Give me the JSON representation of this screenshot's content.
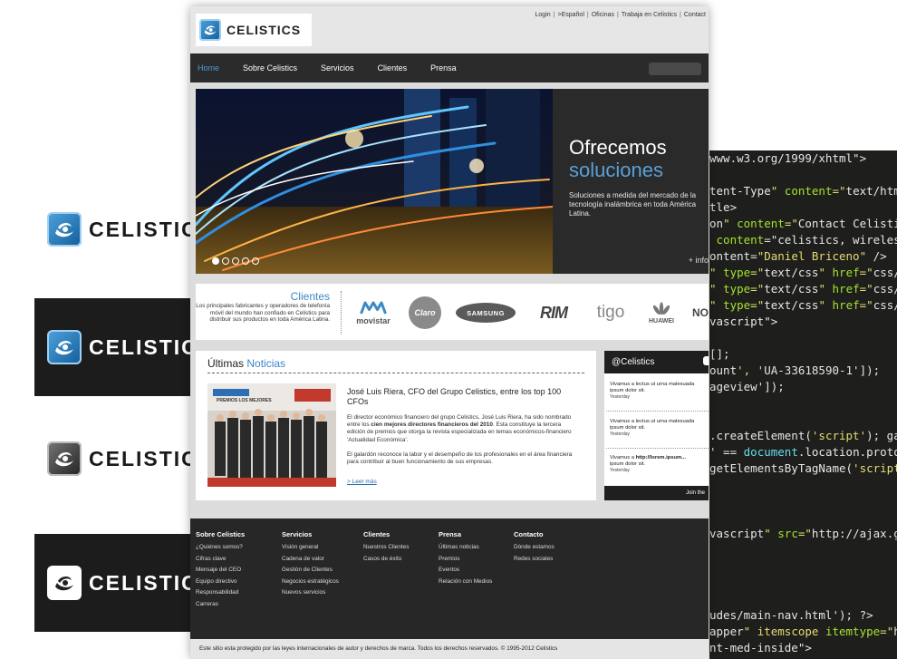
{
  "collage": {
    "brand": "CELISTICS",
    "code_lines": [
      "www.w3.org/1999/xhtml\">",
      "",
      "tent-Type\" content=\"text/html",
      "tle>",
      "on\" content=\"Contact Celistic",
      " content=\"celistics, wireless",
      "ontent=\"Daniel Briceno\" />",
      "\" type=\"text/css\" href=\"css/s",
      "\" type=\"text/css\" href=\"css/r",
      "\" type=\"text/css\" href=\"css/t",
      "vascript\">",
      "",
      "[];",
      "ount', 'UA-33618590-1']);",
      "ageview']);",
      "",
      "",
      ".createElement('script'); ga.",
      "' == document.location.protoc",
      "getElementsByTagName('script'",
      "",
      "",
      "",
      "vascript\" src=\"http://ajax.go",
      "",
      "",
      "",
      "",
      "udes/main-nav.html'); ?>",
      "apper\" itemscope itemtype=\"ht",
      "nt-med-inside\">"
    ]
  },
  "site": {
    "logo_text": "CELISTICS",
    "utility_links": [
      "Login",
      ">Español",
      "Oficinas",
      "Trabaja en Celistics",
      "Contact"
    ],
    "nav": [
      {
        "label": "Home",
        "active": true
      },
      {
        "label": "Sobre Celistics"
      },
      {
        "label": "Servicios"
      },
      {
        "label": "Clientes"
      },
      {
        "label": "Prensa"
      }
    ],
    "hero": {
      "title_line1": "Ofrecemos",
      "title_line2": "soluciones",
      "description": "Soluciones a medida del mercado de la tecnología inalámbrica en toda América Latina.",
      "more_link": "+ info",
      "slides": 5,
      "active_slide": 1
    },
    "clients": {
      "title": "Clientes",
      "description": "Los principales fabricantes y operadores de telefonía móvil del mundo han confiado en Celistics para distribuir sus productos en toda América Latina.",
      "brands": [
        "movistar",
        "Claro",
        "SAMSUNG",
        "RIM",
        "tigo",
        "HUAWEI",
        "NO"
      ]
    },
    "news": {
      "title_plain": "Últimas",
      "title_accent": "Noticias",
      "headline": "José Luis Riera, CFO del Grupo Celistics, entre los top 100 CFOs",
      "para1_a": "El director económico financiero del grupo Celistics, José Luis Riera, ha sido nombrado entre los ",
      "para1_b": "cien mejores directores financieros del 2010",
      "para1_c": ". Esta constituye la tercera edición de premios que otorga la revista especializada en temas económicos-financiero 'Actualidad Económica'.",
      "para2": "El galardón reconoce la labor y el desempeño de los profesionales en el área financiera para contribuir al buen funcionamiento de sus empresas.",
      "more_link": "> Leer más",
      "image_caption": "PREMIOS LOS MEJORES"
    },
    "twitter": {
      "handle": "@Celistics",
      "tweets": [
        {
          "text": "Vivamus a lectus ut urna malesuada",
          "text2": "ipsum dolor sit.",
          "when": "Yesterday"
        },
        {
          "text": "Vivamus a lectus ut urna malesuada",
          "text2": "ipsum dolor sit.",
          "when": "Yesterday"
        },
        {
          "text_a": "Vivamus a ",
          "link": "http://lorem.ipsum...",
          "text2": "ipsum dolor sit.",
          "when": "Yesterday"
        }
      ],
      "footer": "Join the"
    },
    "footer": {
      "columns": [
        {
          "heading": "Sobre Celistics",
          "links": [
            "¿Quiénes somos?",
            "Cifras clave",
            "Mensaje del CEO",
            "Equipo directivo",
            "Responsabilidad",
            "Carreras"
          ]
        },
        {
          "heading": "Servicios",
          "links": [
            "Visión general",
            "Cadena de valor",
            "Gestión de Clientes",
            "Negocios estratégicos",
            "Nuevos servicios"
          ]
        },
        {
          "heading": "Clientes",
          "links": [
            "Nuestros Clientes",
            "Casos de éxito"
          ]
        },
        {
          "heading": "Prensa",
          "links": [
            "Últimas noticias",
            "Premios",
            "Eventos",
            "Relación con Medios"
          ]
        },
        {
          "heading": "Contacto",
          "links": [
            "Dónde estamos",
            "Redes sociales"
          ]
        }
      ],
      "copyright": "Este sitio esta protegido por las leyes internacionales de autor y derechos de marca. Todos los derechos reservados. © 1995-2012 Celistics"
    }
  },
  "colors": {
    "accent": "#3a87c8",
    "nav_bg": "#2b2b2b",
    "footer_bg": "#272727",
    "code_bg": "#1e1f1c"
  }
}
